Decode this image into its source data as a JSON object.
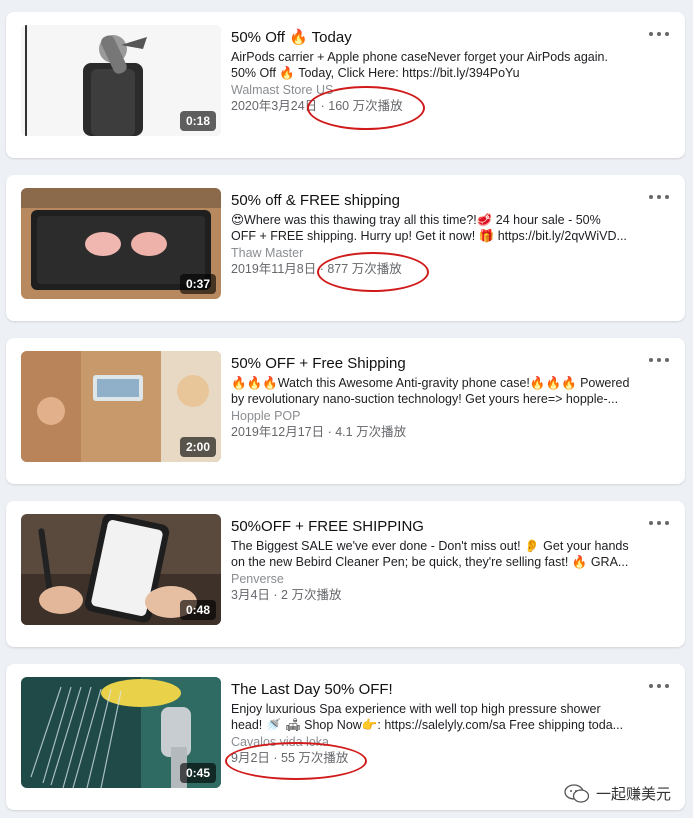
{
  "ads": [
    {
      "title": "50% Off 🔥 Today",
      "desc1": "AirPods carrier + Apple phone caseNever forget your AirPods again.",
      "desc2": "50% Off 🔥 Today, Click Here: https://bit.ly/394PoYu",
      "source": "Walmast Store US",
      "date": "2020年3月24日",
      "views": "160 万次播放",
      "duration": "0:18"
    },
    {
      "title": "50% off & FREE shipping",
      "desc1": "😍Where was this thawing tray all this time?!🥩 24 hour sale - 50%",
      "desc2": "OFF + FREE shipping. Hurry up! Get it now! 🎁 https://bit.ly/2qvWiVD...",
      "source": "Thaw Master",
      "date": "2019年11月8日",
      "views": "877 万次播放",
      "duration": "0:37"
    },
    {
      "title": "50% OFF + Free Shipping",
      "desc1": "🔥🔥🔥Watch this Awesome Anti-gravity phone case!🔥🔥🔥 Powered",
      "desc2": "by revolutionary nano-suction technology! Get yours here=> hopple-...",
      "source": "Hopple POP",
      "date": "2019年12月17日",
      "views": "4.1 万次播放",
      "duration": "2:00"
    },
    {
      "title": "50%OFF + FREE SHIPPING",
      "desc1": "The Biggest SALE we've ever done - Don't miss out! 👂 Get your hands",
      "desc2": "on the new Bebird Cleaner Pen; be quick, they're selling fast! 🔥 GRA...",
      "source": "Penverse",
      "date": "3月4日",
      "views": "2 万次播放",
      "duration": "0:48"
    },
    {
      "title": "The Last Day 50% OFF!",
      "desc1": "Enjoy luxurious Spa experience with well top high pressure shower",
      "desc2": "head! 🚿 🛋 Shop Now👉: https://salelyly.com/sa Free shipping toda...",
      "source": "Cavalos vida loka",
      "date": "9月2日",
      "views": "55 万次播放",
      "duration": "0:45"
    }
  ],
  "separator": " · ",
  "watermark": "一起赚美元",
  "colors": {
    "highlight_circle": "#d11a1a",
    "card_bg": "#ffffff",
    "page_bg": "#edf0f5"
  }
}
